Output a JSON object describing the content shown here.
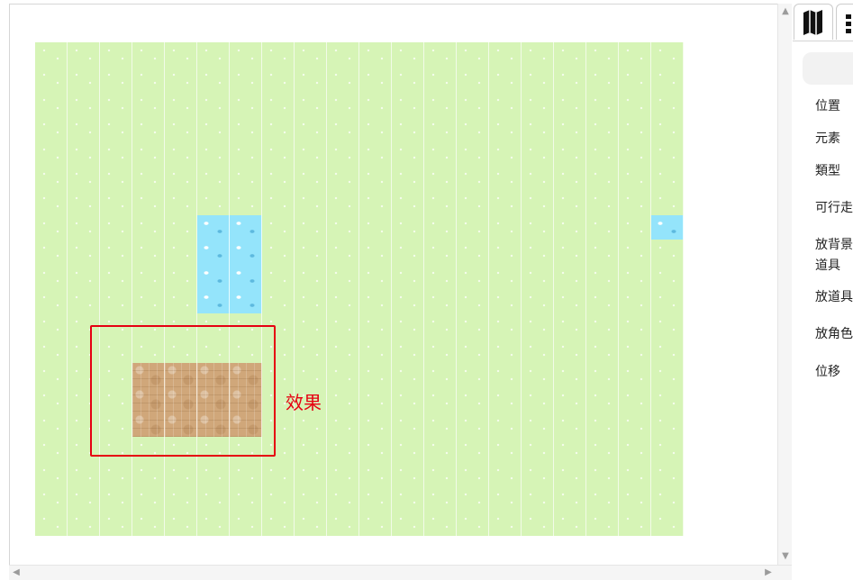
{
  "annotation": {
    "label": "效果",
    "color": "#e60012"
  },
  "map": {
    "columns": 20,
    "rows": 20,
    "base_tile": "grass",
    "special_tiles": [
      {
        "type": "water",
        "col": 5,
        "row": 7
      },
      {
        "type": "water",
        "col": 6,
        "row": 7
      },
      {
        "type": "water",
        "col": 5,
        "row": 8
      },
      {
        "type": "water",
        "col": 6,
        "row": 8
      },
      {
        "type": "water",
        "col": 5,
        "row": 9
      },
      {
        "type": "water",
        "col": 6,
        "row": 9
      },
      {
        "type": "water",
        "col": 5,
        "row": 10
      },
      {
        "type": "water",
        "col": 6,
        "row": 10
      },
      {
        "type": "water",
        "col": 19,
        "row": 7
      },
      {
        "type": "wood",
        "col": 3,
        "row": 13
      },
      {
        "type": "wood",
        "col": 4,
        "row": 13
      },
      {
        "type": "wood",
        "col": 5,
        "row": 13
      },
      {
        "type": "wood",
        "col": 6,
        "row": 13
      },
      {
        "type": "wood",
        "col": 3,
        "row": 14
      },
      {
        "type": "wood",
        "col": 4,
        "row": 14
      },
      {
        "type": "wood",
        "col": 5,
        "row": 14
      },
      {
        "type": "wood",
        "col": 6,
        "row": 14
      },
      {
        "type": "wood",
        "col": 3,
        "row": 15
      },
      {
        "type": "wood",
        "col": 4,
        "row": 15
      },
      {
        "type": "wood",
        "col": 5,
        "row": 15
      },
      {
        "type": "wood",
        "col": 6,
        "row": 15
      }
    ],
    "colors": {
      "grass": "#d6f4b6",
      "water": "#94e4fb",
      "wood": "#d0a77a"
    }
  },
  "side_panel": {
    "tabs": [
      {
        "icon": "map-icon"
      },
      {
        "icon": "more-icon"
      }
    ],
    "labels": [
      {
        "text": "位置"
      },
      {
        "text": "元素"
      },
      {
        "text": "類型"
      },
      {
        "text": "可行走"
      },
      {
        "text": "放背景"
      },
      {
        "text": "道具"
      },
      {
        "text": "放道具"
      },
      {
        "text": "放角色"
      },
      {
        "text": "位移"
      }
    ]
  }
}
